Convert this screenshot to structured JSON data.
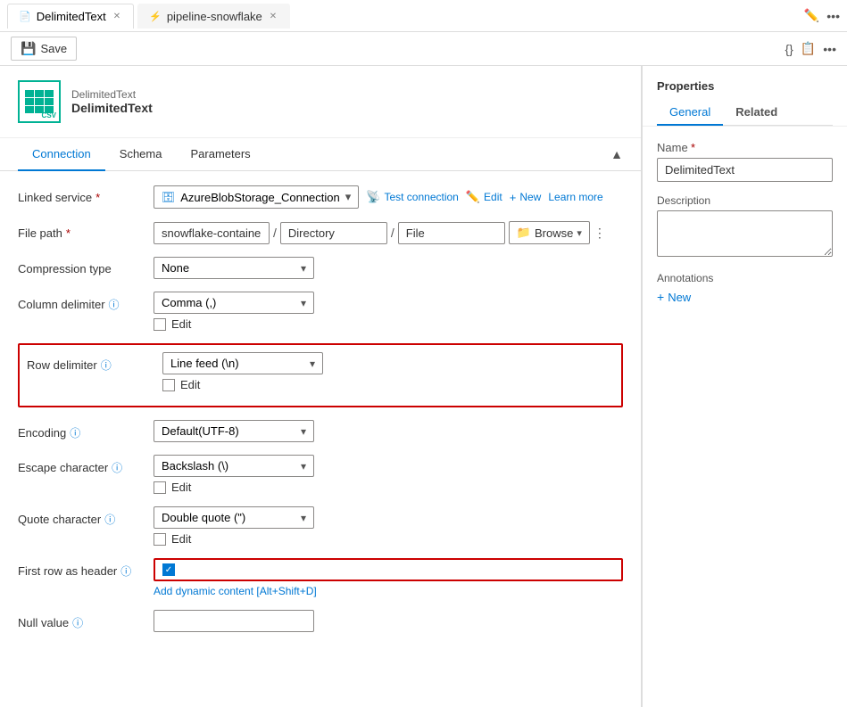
{
  "tabs": [
    {
      "id": "delimited",
      "label": "DelimitedText",
      "icon": "📄",
      "active": true,
      "closable": true
    },
    {
      "id": "pipeline",
      "label": "pipeline-snowflake",
      "icon": "⚡",
      "active": false,
      "closable": true
    }
  ],
  "toolbar": {
    "save_label": "Save",
    "toolbar_icons": [
      "{}",
      "📋",
      "•••"
    ]
  },
  "dataset": {
    "subtitle": "DelimitedText",
    "title": "DelimitedText"
  },
  "section_tabs": [
    "Connection",
    "Schema",
    "Parameters"
  ],
  "active_section_tab": "Connection",
  "form": {
    "linked_service": {
      "label": "Linked service",
      "required": true,
      "value": "AzureBlobStorage_Connection",
      "actions": [
        "Test connection",
        "Edit",
        "New",
        "Learn more"
      ]
    },
    "file_path": {
      "label": "File path",
      "required": true,
      "container": "snowflake-container",
      "directory": "Directory",
      "file": "File",
      "browse_label": "Browse"
    },
    "compression_type": {
      "label": "Compression type",
      "value": "None"
    },
    "column_delimiter": {
      "label": "Column delimiter",
      "has_info": true,
      "value": "Comma (,)",
      "edit_label": "Edit"
    },
    "row_delimiter": {
      "label": "Row delimiter",
      "has_info": true,
      "value": "Line feed (\\n)",
      "edit_label": "Edit",
      "highlighted": true
    },
    "encoding": {
      "label": "Encoding",
      "has_info": true,
      "value": "Default(UTF-8)"
    },
    "escape_character": {
      "label": "Escape character",
      "has_info": true,
      "value": "Backslash (\\)",
      "edit_label": "Edit"
    },
    "quote_character": {
      "label": "Quote character",
      "has_info": true,
      "value": "Double quote (\")",
      "edit_label": "Edit"
    },
    "first_row_as_header": {
      "label": "First row as header",
      "has_info": true,
      "checked": true,
      "highlighted": true,
      "dynamic_content": "Add dynamic content [Alt+Shift+D]"
    },
    "null_value": {
      "label": "Null value",
      "has_info": true,
      "value": ""
    }
  },
  "properties": {
    "title": "Properties",
    "tabs": [
      "General",
      "Related"
    ],
    "active_tab": "General",
    "name_label": "Name",
    "name_required": true,
    "name_value": "DelimitedText",
    "description_label": "Description",
    "description_value": "",
    "annotations_label": "Annotations",
    "add_new_label": "New"
  }
}
